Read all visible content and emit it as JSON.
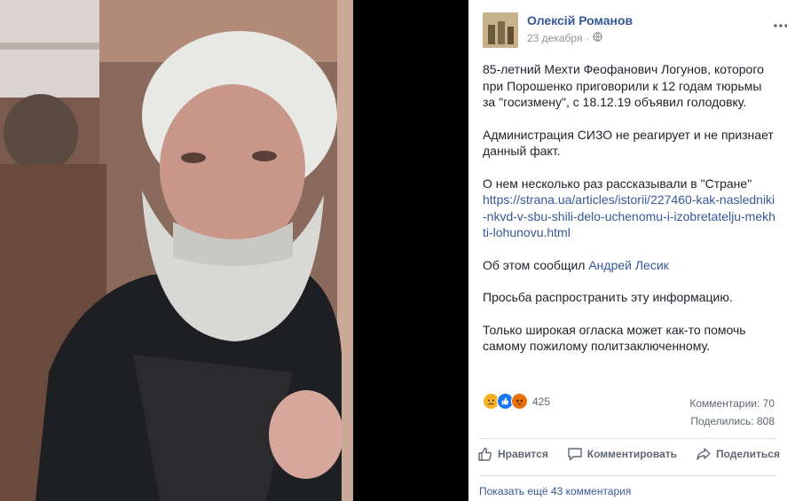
{
  "post": {
    "author": "Олексій Романов",
    "date": "23 декабря",
    "privacy_icon": "globe-icon",
    "menu_icon": "ellipsis-icon",
    "paragraphs": {
      "p1": "85-летний Мехти Феофанович Логунов, которого при Порошенко приговорили к 12 годам тюрьмы за \"госизмену\", с 18.12.19 объявил голодовку.",
      "p2": "Администрация СИЗО не реагирует и не признает данный факт.",
      "p3": "О нем несколько раз рассказывали в \"Стране\"",
      "link": "https://strana.ua/articles/istorii/227460-kak-nasledniki-nkvd-v-sbu-shili-delo-uchenomu-i-izobretatelju-mekhti-lohunovu.html",
      "p4_prefix": "Об этом сообщил ",
      "p4_mention": "Андрей Лесик",
      "p5": "Просьба распространить эту информацию.",
      "p6": "Только широкая огласка может как-то помочь самому пожилому политзаключенному."
    }
  },
  "reactions": {
    "icons": [
      "sad-icon",
      "like-icon",
      "angry-icon"
    ],
    "count": "425",
    "comments": "Комментарии: 70",
    "shares": "Поделились: 808"
  },
  "actions": {
    "like": "Нравится",
    "comment": "Комментировать",
    "share": "Поделиться"
  },
  "comments_footer": {
    "show_more": "Показать ещё 43 комментария"
  },
  "colors": {
    "link": "#385898",
    "author": "#365899",
    "text": "#1d2129",
    "muted": "#606770"
  }
}
